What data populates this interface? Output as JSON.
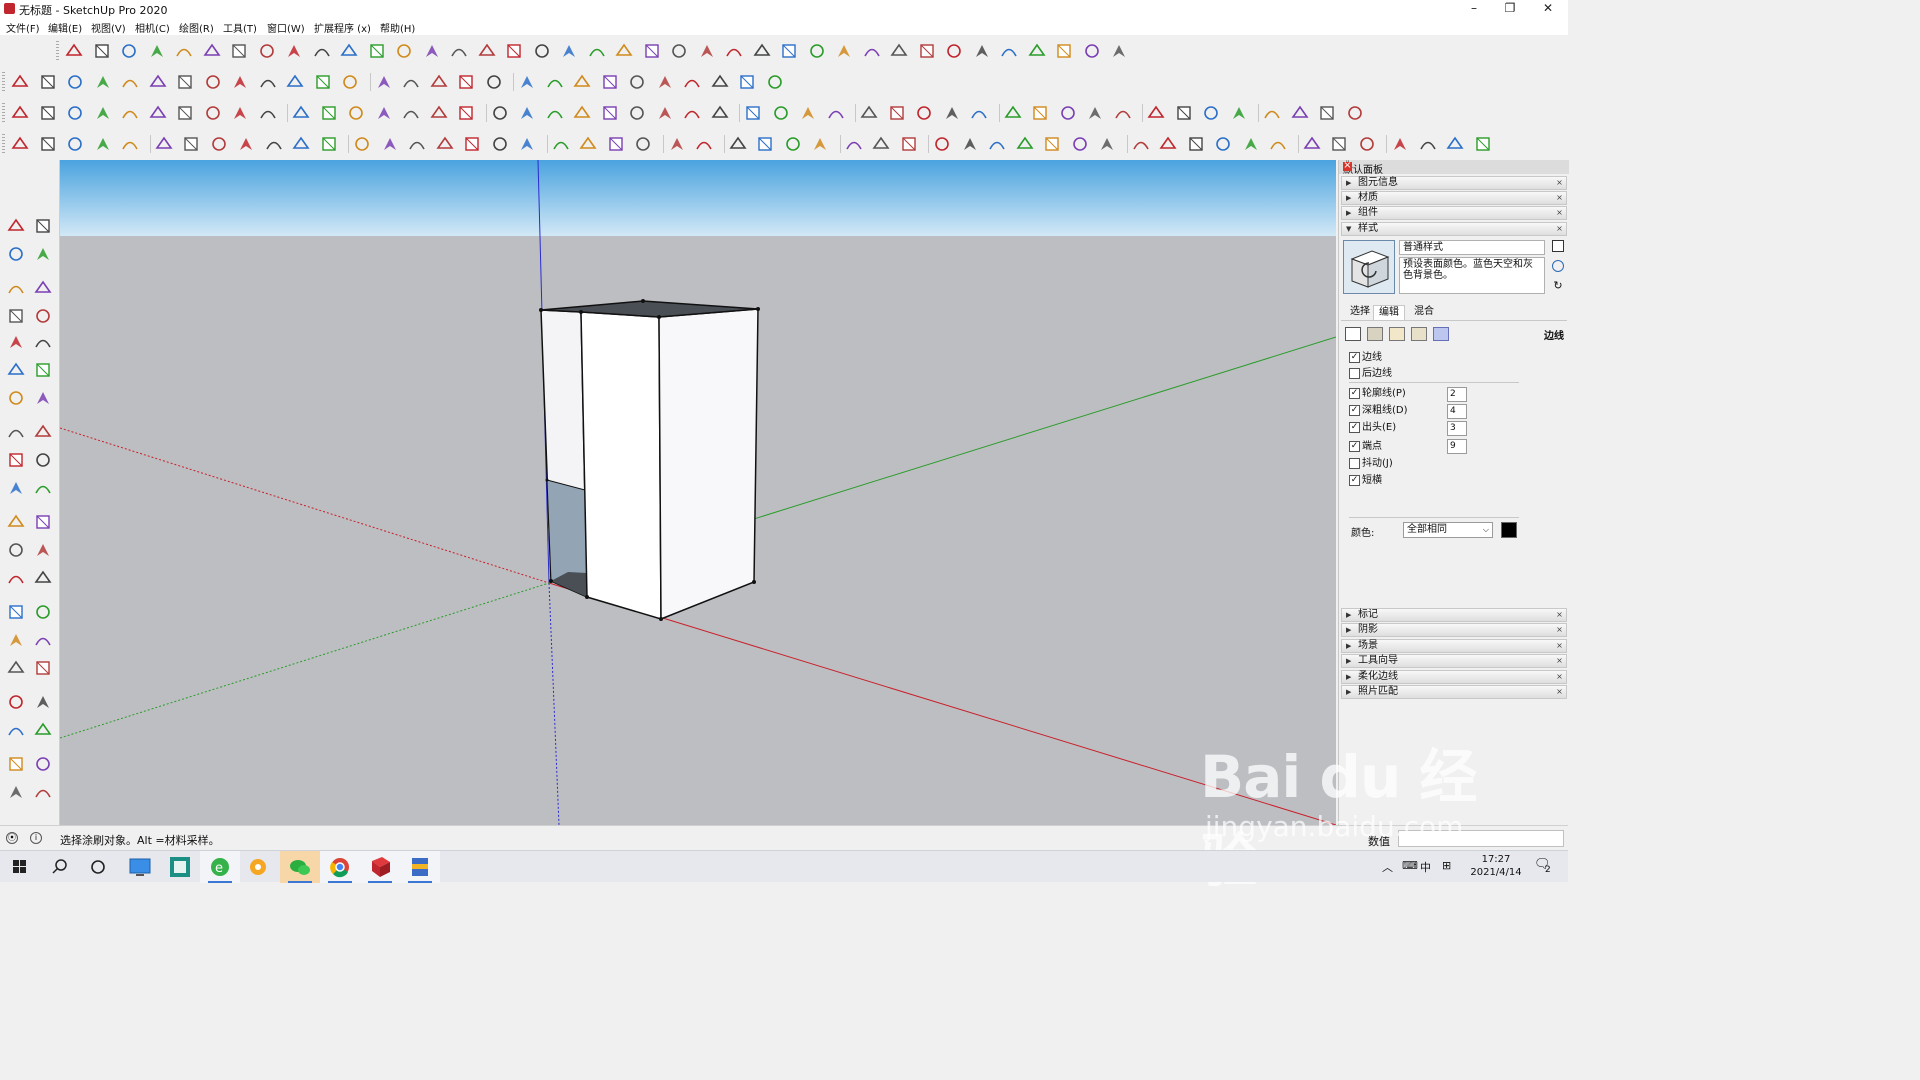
{
  "window": {
    "title": "无标题 - SketchUp Pro 2020",
    "minimize_glyph": "–",
    "maximize_glyph": "❐",
    "close_glyph": "✕"
  },
  "menu": [
    "文件(F)",
    "编辑(E)",
    "视图(V)",
    "相机(C)",
    "绘图(R)",
    "工具(T)",
    "窗口(W)",
    "扩展程序 (x)",
    "帮助(H)"
  ],
  "tray": {
    "title": "默认面板",
    "sections_top": [
      "图元信息",
      "材质",
      "组件",
      "样式"
    ],
    "style": {
      "name": "普通样式",
      "description": "预设表面颜色。蓝色天空和灰色背景色。"
    },
    "tabs": [
      "选择",
      "编辑",
      "混合"
    ],
    "edit_section_label": "边线",
    "options": [
      {
        "label": "边线",
        "checked": true
      },
      {
        "label": "后边线",
        "checked": false
      },
      {
        "label": "轮廓线(P)",
        "checked": true,
        "value": "2"
      },
      {
        "label": "深粗线(D)",
        "checked": true,
        "value": "4"
      },
      {
        "label": "出头(E)",
        "checked": true,
        "value": "3"
      },
      {
        "label": "端点",
        "checked": true,
        "value": "9"
      },
      {
        "label": "抖动(J)",
        "checked": false
      },
      {
        "label": "短横",
        "checked": true
      }
    ],
    "color_label": "颜色:",
    "color_value": "全部相同",
    "sections_bottom": [
      "标记",
      "阴影",
      "场景",
      "工具向导",
      "柔化边线",
      "照片匹配"
    ]
  },
  "status": {
    "message": "选择涂刷对象。Alt =材料采样。",
    "measurement_label": "数值"
  },
  "watermark": {
    "line1": "Bai du 经验",
    "line2": "jingyan.baidu.com"
  },
  "taskbar": {
    "ime_lang": "中",
    "time": "17:27",
    "date": "2021/4/14",
    "notifications": "2"
  },
  "colors": {
    "sky_top": "#4aa3df",
    "sky_bottom": "#cfe6f5",
    "ground": "#bdbec2",
    "axis_red": "#c8202a",
    "axis_green": "#2a9c2a",
    "axis_blue": "#2b2bd0",
    "sketchup_red": "#c0262d",
    "toolbar_bg": "#f0f0f0"
  }
}
